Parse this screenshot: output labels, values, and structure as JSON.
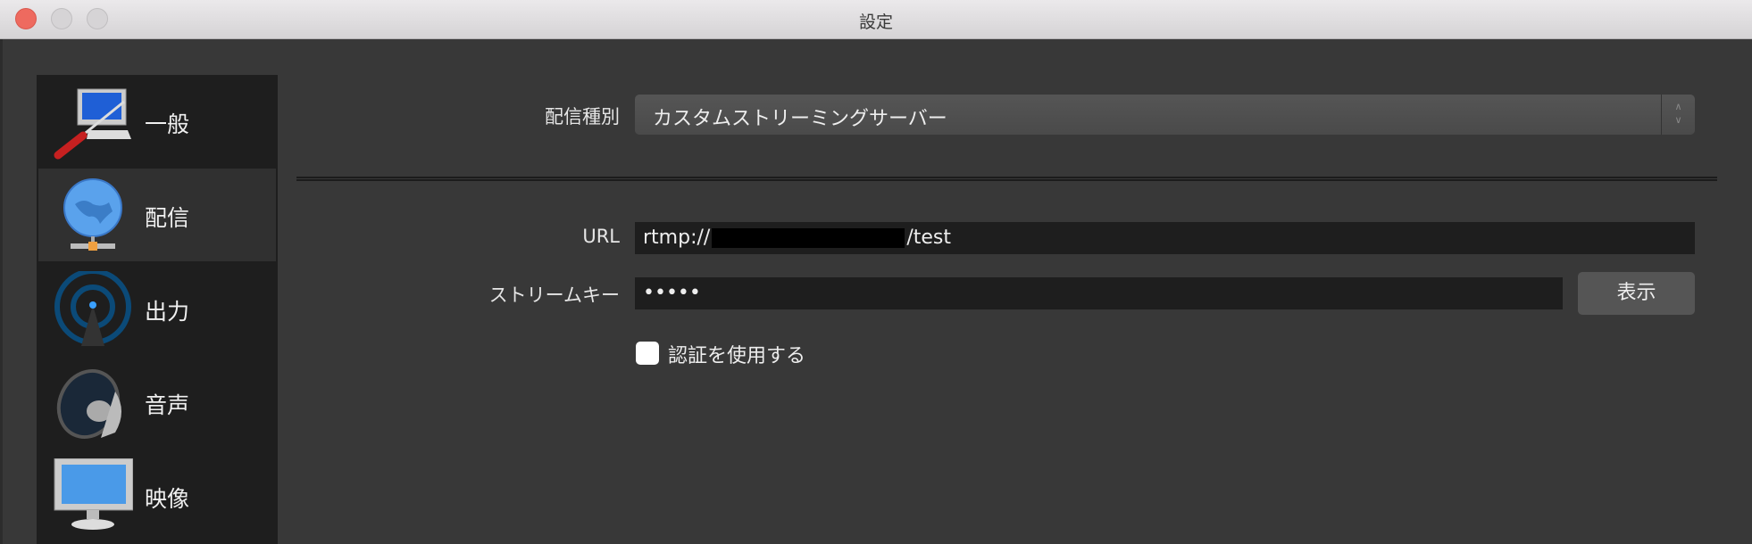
{
  "window": {
    "title": "設定"
  },
  "sidebar": {
    "items": [
      {
        "label": "一般",
        "icon": "general-settings-icon"
      },
      {
        "label": "配信",
        "icon": "globe-network-icon",
        "selected": true
      },
      {
        "label": "出力",
        "icon": "broadcast-antenna-icon"
      },
      {
        "label": "音声",
        "icon": "speaker-icon"
      },
      {
        "label": "映像",
        "icon": "monitor-icon"
      }
    ]
  },
  "stream": {
    "service_label": "配信種別",
    "service_value": "カスタムストリーミングサーバー",
    "url_label": "URL",
    "url_prefix": "rtmp://",
    "url_suffix": "/test",
    "key_label": "ストリームキー",
    "key_value": "•••••",
    "show_button": "表示",
    "auth_label": "認証を使用する",
    "auth_checked": false
  }
}
